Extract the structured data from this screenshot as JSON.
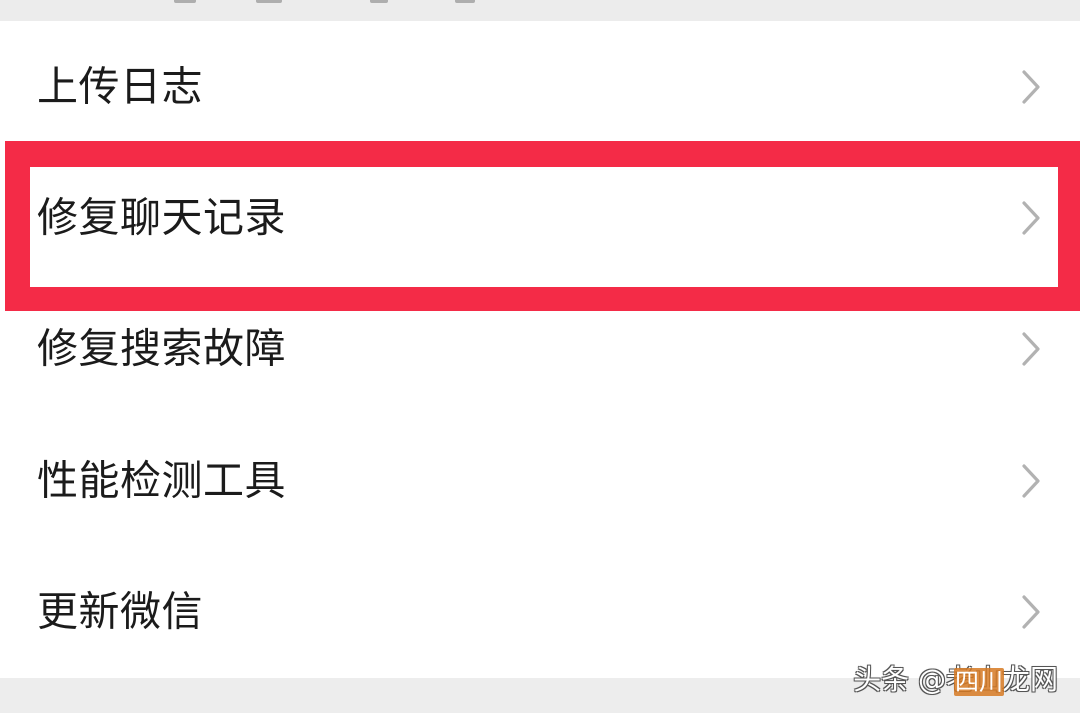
{
  "menu": {
    "items": [
      {
        "label": "上传日志"
      },
      {
        "label": "修复聊天记录",
        "highlighted": true
      },
      {
        "label": "修复搜索故障"
      },
      {
        "label": "性能检测工具"
      },
      {
        "label": "更新微信"
      }
    ]
  },
  "icons": {
    "chevron": "chevron-right-icon"
  },
  "colors": {
    "highlight": "#f42b47",
    "chevron": "#b2b2b2",
    "text": "#1b1b1b",
    "background": "#ededed"
  },
  "watermark": {
    "text": "头条 @老山龙网",
    "overlay_text": "四川"
  }
}
